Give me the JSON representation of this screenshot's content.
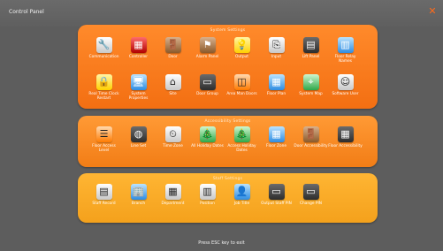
{
  "window": {
    "title": "Control Panel",
    "close_glyph": "✕"
  },
  "sections": [
    {
      "title": "System Settings",
      "items": [
        {
          "label": "Communication",
          "icon": "tools-icon",
          "glyph": "🔧",
          "style": "silver"
        },
        {
          "label": "Controller",
          "icon": "controller-icon",
          "glyph": "▦",
          "style": "red"
        },
        {
          "label": "Door",
          "icon": "door-icon",
          "glyph": "🚪",
          "style": "brown"
        },
        {
          "label": "Alarm Panel",
          "icon": "alarm-panel-icon",
          "glyph": "⚑",
          "style": "brown"
        },
        {
          "label": "Output",
          "icon": "lightbulb-icon",
          "glyph": "💡",
          "style": "yellow"
        },
        {
          "label": "Input",
          "icon": "input-icon",
          "glyph": "⎘",
          "style": "silver"
        },
        {
          "label": "Lift Panel",
          "icon": "lift-panel-icon",
          "glyph": "▤",
          "style": "dark"
        },
        {
          "label": "Floor Relay Names",
          "icon": "floor-relay-icon",
          "glyph": "▥",
          "style": "blue"
        },
        {
          "label": "Real Time Clock Restart",
          "icon": "lock-icon",
          "glyph": "🔒",
          "style": "yellow"
        },
        {
          "label": "System Properties",
          "icon": "monitor-icon",
          "glyph": "🖥",
          "style": "blue"
        },
        {
          "label": "Site",
          "icon": "home-icon",
          "glyph": "⌂",
          "style": "silver"
        },
        {
          "label": "Door Group",
          "icon": "door-group-icon",
          "glyph": "▭",
          "style": "dark"
        },
        {
          "label": "Area Man Doors",
          "icon": "area-icon",
          "glyph": "◫",
          "style": "orange"
        },
        {
          "label": "Floor Plan",
          "icon": "floor-plan-icon",
          "glyph": "▦",
          "style": "blue"
        },
        {
          "label": "System Map",
          "icon": "map-icon",
          "glyph": "⌖",
          "style": "green"
        },
        {
          "label": "Software User",
          "icon": "software-user-icon",
          "glyph": "☺",
          "style": "silver"
        }
      ]
    },
    {
      "title": "Accessibility Settings",
      "items": [
        {
          "label": "Floor Access Level",
          "icon": "access-level-icon",
          "glyph": "☰",
          "style": "orange"
        },
        {
          "label": "Line Set",
          "icon": "line-set-icon",
          "glyph": "◍",
          "style": "dark"
        },
        {
          "label": "Time Zone",
          "icon": "clock-icon",
          "glyph": "⏲",
          "style": "silver"
        },
        {
          "label": "All Holiday Dates",
          "icon": "holiday-tree-icon",
          "glyph": "🎄",
          "style": "green"
        },
        {
          "label": "Access Holiday Dates",
          "icon": "holiday-info-icon",
          "glyph": "🎄",
          "style": "green"
        },
        {
          "label": "Floor Zone",
          "icon": "floor-zone-icon",
          "glyph": "▦",
          "style": "blue"
        },
        {
          "label": "Door Accessibility",
          "icon": "door-access-icon",
          "glyph": "🚪",
          "style": "brown"
        },
        {
          "label": "Floor Accessibility",
          "icon": "floor-access-icon",
          "glyph": "▦",
          "style": "dark"
        }
      ]
    },
    {
      "title": "Staff Settings",
      "items": [
        {
          "label": "Staff Record",
          "icon": "staff-record-icon",
          "glyph": "▤",
          "style": "silver"
        },
        {
          "label": "Branch",
          "icon": "branch-icon",
          "glyph": "🏢",
          "style": "blue"
        },
        {
          "label": "Department",
          "icon": "department-icon",
          "glyph": "▦",
          "style": "silver"
        },
        {
          "label": "Position",
          "icon": "position-icon",
          "glyph": "▥",
          "style": "silver"
        },
        {
          "label": "Job Title",
          "icon": "job-title-icon",
          "glyph": "👤",
          "style": "blue"
        },
        {
          "label": "Output Staff PIN",
          "icon": "output-pin-icon",
          "glyph": "▭",
          "style": "dark"
        },
        {
          "label": "Change PIN",
          "icon": "change-pin-icon",
          "glyph": "▭",
          "style": "dark"
        }
      ]
    }
  ],
  "footer": {
    "text": "Press ESC key to exit"
  }
}
